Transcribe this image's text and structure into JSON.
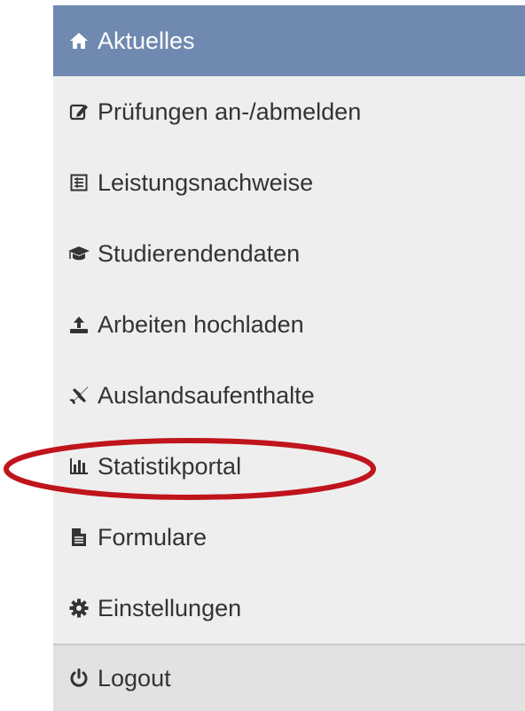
{
  "menu": {
    "items": [
      {
        "label": "Aktuelles",
        "icon": "home-icon",
        "active": true
      },
      {
        "label": "Prüfungen an-/abmelden",
        "icon": "edit-icon"
      },
      {
        "label": "Leistungsnachweise",
        "icon": "list-icon"
      },
      {
        "label": "Studierendendaten",
        "icon": "graduation-cap-icon"
      },
      {
        "label": "Arbeiten hochladen",
        "icon": "upload-icon"
      },
      {
        "label": "Auslandsaufenthalte",
        "icon": "plane-icon"
      },
      {
        "label": "Statistikportal",
        "icon": "bar-chart-icon",
        "highlighted": true
      },
      {
        "label": "Formulare",
        "icon": "file-icon"
      },
      {
        "label": "Einstellungen",
        "icon": "gear-icon"
      },
      {
        "label": "Logout",
        "icon": "power-icon"
      }
    ]
  },
  "colors": {
    "active_bg": "#7089b0",
    "menu_bg": "#eeeeee",
    "logout_bg": "#e2e2e2",
    "text": "#333333",
    "highlight_ring": "#c0141c"
  }
}
